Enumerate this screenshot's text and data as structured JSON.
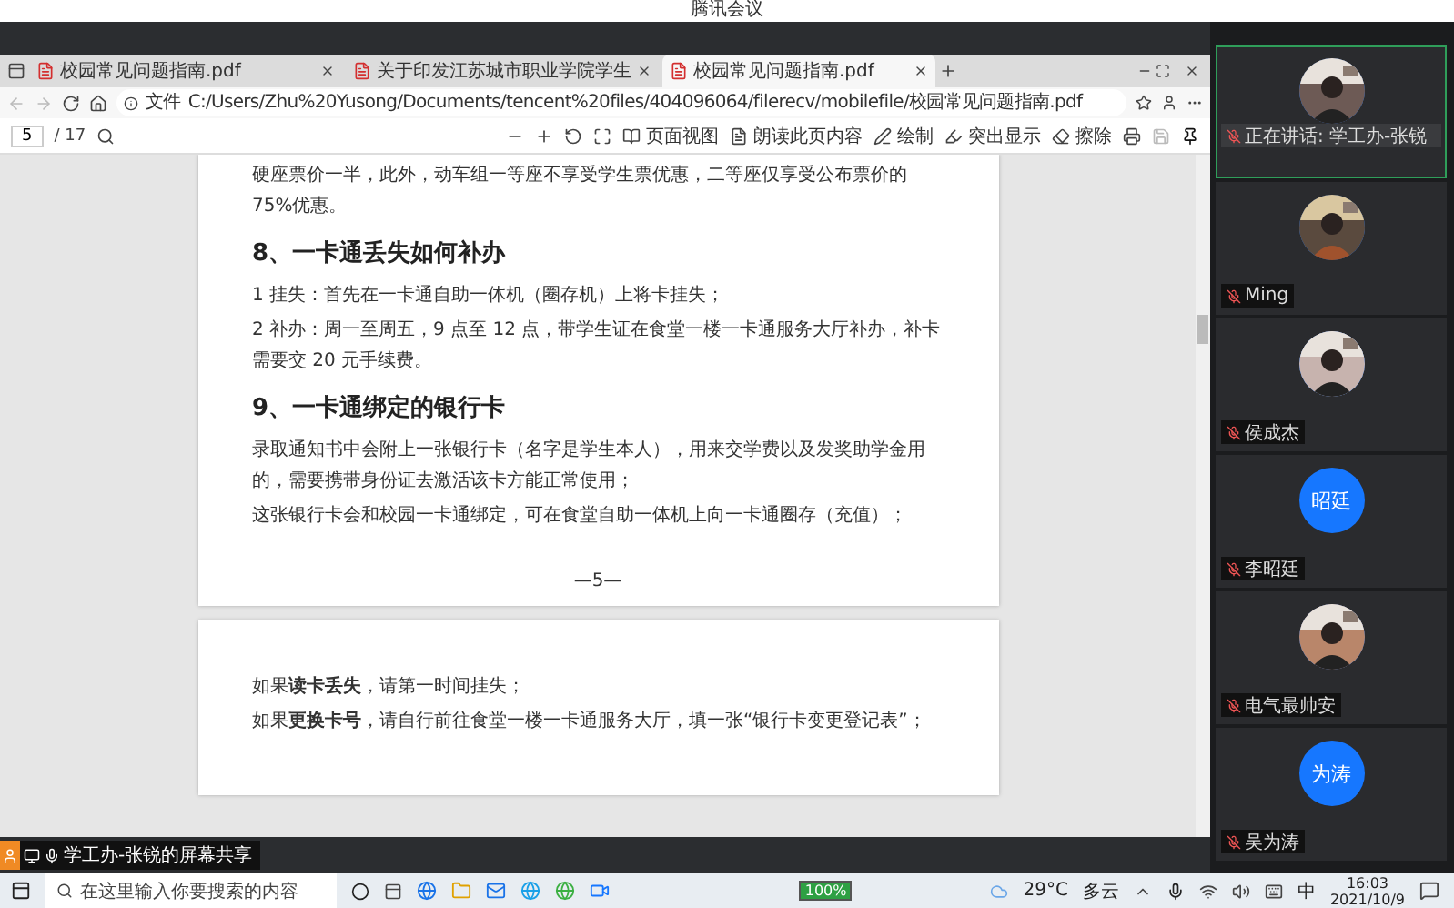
{
  "meeting_title": "腾讯会议",
  "browser": {
    "tabs": [
      {
        "label": "校园常见问题指南.pdf",
        "selected": false
      },
      {
        "label": "关于印发江苏城市职业学院学生",
        "selected": false
      },
      {
        "label": "校园常见问题指南.pdf",
        "selected": true
      }
    ],
    "address": {
      "prefix": "文件",
      "url": "C:/Users/Zhu%20Yusong/Documents/tencent%20files/404096064/filerecv/mobilefile/校园常见问题指南.pdf"
    },
    "pdf_toolbar": {
      "page": "5",
      "page_count": "/ 17",
      "tools": [
        {
          "kind": "view",
          "label": "页面视图"
        },
        {
          "kind": "read",
          "label": "朗读此页内容"
        },
        {
          "kind": "draw",
          "label": "绘制"
        },
        {
          "kind": "highlight",
          "label": "突出显示"
        },
        {
          "kind": "erase",
          "label": "擦除"
        }
      ]
    },
    "pages": [
      {
        "blocks": [
          {
            "kind": "paragraph",
            "text": "硬座票价一半，此外，动车组一等座不享受学生票优惠，二等座仅享受公布票价的75%优惠。"
          },
          {
            "kind": "heading",
            "text": "8、一卡通丢失如何补办"
          },
          {
            "kind": "paragraph",
            "text": "1 挂失：首先在一卡通自助一体机（圈存机）上将卡挂失；"
          },
          {
            "kind": "paragraph",
            "text": "2 补办：周一至周五，9 点至 12 点，带学生证在食堂一楼一卡通服务大厅补办，补卡需要交 20 元手续费。"
          },
          {
            "kind": "heading",
            "text": "9、一卡通绑定的银行卡"
          },
          {
            "kind": "paragraph",
            "text": "录取通知书中会附上一张银行卡（名字是学生本人），用来交学费以及发奖助学金用的，需要携带身份证去激活该卡方能正常使用；"
          },
          {
            "kind": "paragraph",
            "text": "这张银行卡会和校园一卡通绑定，可在食堂自助一体机上向一卡通圈存（充值）；"
          },
          {
            "kind": "footer",
            "text": "—5—"
          }
        ]
      },
      {
        "blocks": [
          {
            "kind": "paragraph",
            "text": "如果**读卡丢失**，请第一时间挂失；"
          },
          {
            "kind": "paragraph",
            "text": "如果**更换卡号**，请自行前往食堂一楼一卡通服务大厅，填一张“银行卡变更登记表”；"
          }
        ]
      }
    ]
  },
  "share_label": "学工办-张锐的屏幕共享",
  "participants": [
    {
      "label": "正在讲话: 学工办-张锐",
      "speaking": true
    },
    {
      "label": "Ming",
      "speaking": false
    },
    {
      "label": "侯成杰",
      "speaking": false
    },
    {
      "label": "李昭廷",
      "speaking": false,
      "avatar": {
        "kind": "initials",
        "text": "昭廷"
      }
    },
    {
      "label": "电气最帅安",
      "speaking": false
    },
    {
      "label": "吴为涛",
      "speaking": false,
      "avatar": {
        "kind": "initials",
        "text": "为涛"
      }
    }
  ],
  "taskbar": {
    "search_placeholder": "在这里输入你要搜索的内容",
    "battery": "100%",
    "temperature": "29°C",
    "weather": "多云",
    "ime": "中",
    "time": "16:03",
    "date": "2021/10/9"
  }
}
